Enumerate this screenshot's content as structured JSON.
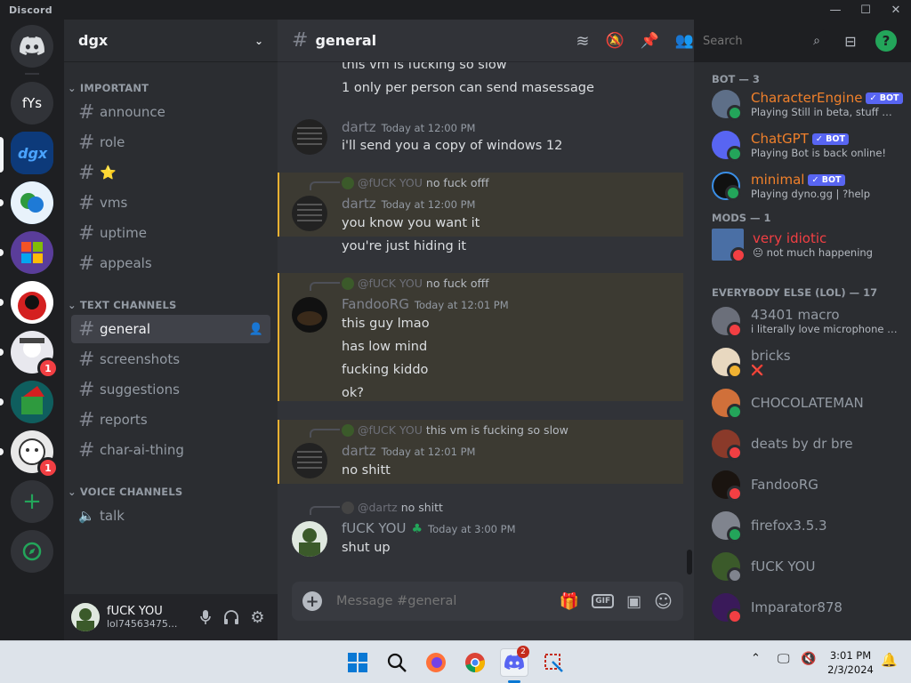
{
  "titlebar": {
    "app_name": "Discord"
  },
  "servers": {
    "label_fys": "fYs",
    "badges": [
      "1",
      "1"
    ]
  },
  "guild": {
    "name": "dgx"
  },
  "categories": {
    "important": "IMPORTANT",
    "text": "TEXT CHANNELS",
    "voice": "VOICE CHANNELS"
  },
  "channels": {
    "announce": "announce",
    "role": "role",
    "star": "⭐",
    "vms": "vms",
    "uptime": "uptime",
    "appeals": "appeals",
    "general": "general",
    "screenshots": "screenshots",
    "suggestions": "suggestions",
    "reports": "reports",
    "char_ai_thing": "char-ai-thing",
    "talk": "talk"
  },
  "user": {
    "name": "fUCK YOU",
    "tag": "lol74563475..."
  },
  "chat": {
    "channel_name": "general",
    "search_placeholder": "Search",
    "composer_placeholder": "Message #general",
    "gif_label": "GIF",
    "messages": {
      "m0_line1": "this vm is fucking so slow",
      "m0_line2": "1 only per person can send masessage",
      "m1_author": "dartz",
      "m1_time": "Today at 12:00 PM",
      "m1_line1": "i'll send you a copy of windows 12",
      "m2_reply_name": "@fUCK YOU",
      "m2_reply_text": "no fuck offf",
      "m2_author": "dartz",
      "m2_time": "Today at 12:00 PM",
      "m2_line1": "you know you want it",
      "m2_line2": "you're just hiding it",
      "m3_reply_name": "@fUCK YOU",
      "m3_reply_text": "no fuck offf",
      "m3_author": "FandooRG",
      "m3_time": "Today at 12:01 PM",
      "m3_line1": "this guy lmao",
      "m3_line2": "has low mind",
      "m3_line3": "fucking kiddo",
      "m3_line4": "ok?",
      "m4_reply_name": "@fUCK YOU",
      "m4_reply_text": "this vm is fucking so slow",
      "m4_author": "dartz",
      "m4_time": "Today at 12:01 PM",
      "m4_line1": "no shitt",
      "m5_reply_name": "@dartz",
      "m5_reply_text": "no shitt",
      "m5_author": "fUCK YOU",
      "m5_time": "Today at 3:00 PM",
      "m5_line1": "shut up"
    }
  },
  "members": {
    "bot_header": "BOT — 3",
    "mods_header": "MODS — 1",
    "everyone_header": "EVERYBODY ELSE (LOL) — 17",
    "bot_badge": "✓ BOT",
    "list": [
      {
        "name": "CharacterEngine",
        "activity": "Playing Still in beta, stuff MA..."
      },
      {
        "name": "ChatGPT",
        "activity": "Playing Bot is back online!"
      },
      {
        "name": "minimal",
        "activity": "Playing dyno.gg | ?help"
      },
      {
        "name": "very idiotic",
        "activity": "not much happening"
      },
      {
        "name": "43401 macro",
        "activity": "i literally love microphone fro..."
      },
      {
        "name": "bricks",
        "activity": "❌"
      },
      {
        "name": "CHOCOLATEMAN",
        "activity": ""
      },
      {
        "name": "deats by dr bre",
        "activity": ""
      },
      {
        "name": "FandooRG",
        "activity": ""
      },
      {
        "name": "firefox3.5.3",
        "activity": ""
      },
      {
        "name": "fUCK YOU",
        "activity": ""
      },
      {
        "name": "Imparator878",
        "activity": ""
      }
    ]
  },
  "taskbar": {
    "time": "3:01 PM",
    "date": "2/3/2024",
    "discord_badge": "2"
  },
  "colors": {
    "bot_name": "#f0802b",
    "mod_name": "#f23f43",
    "online": "#23a55a",
    "dnd": "#f23f43",
    "idle": "#f0b232",
    "blurple": "#5865f2"
  }
}
